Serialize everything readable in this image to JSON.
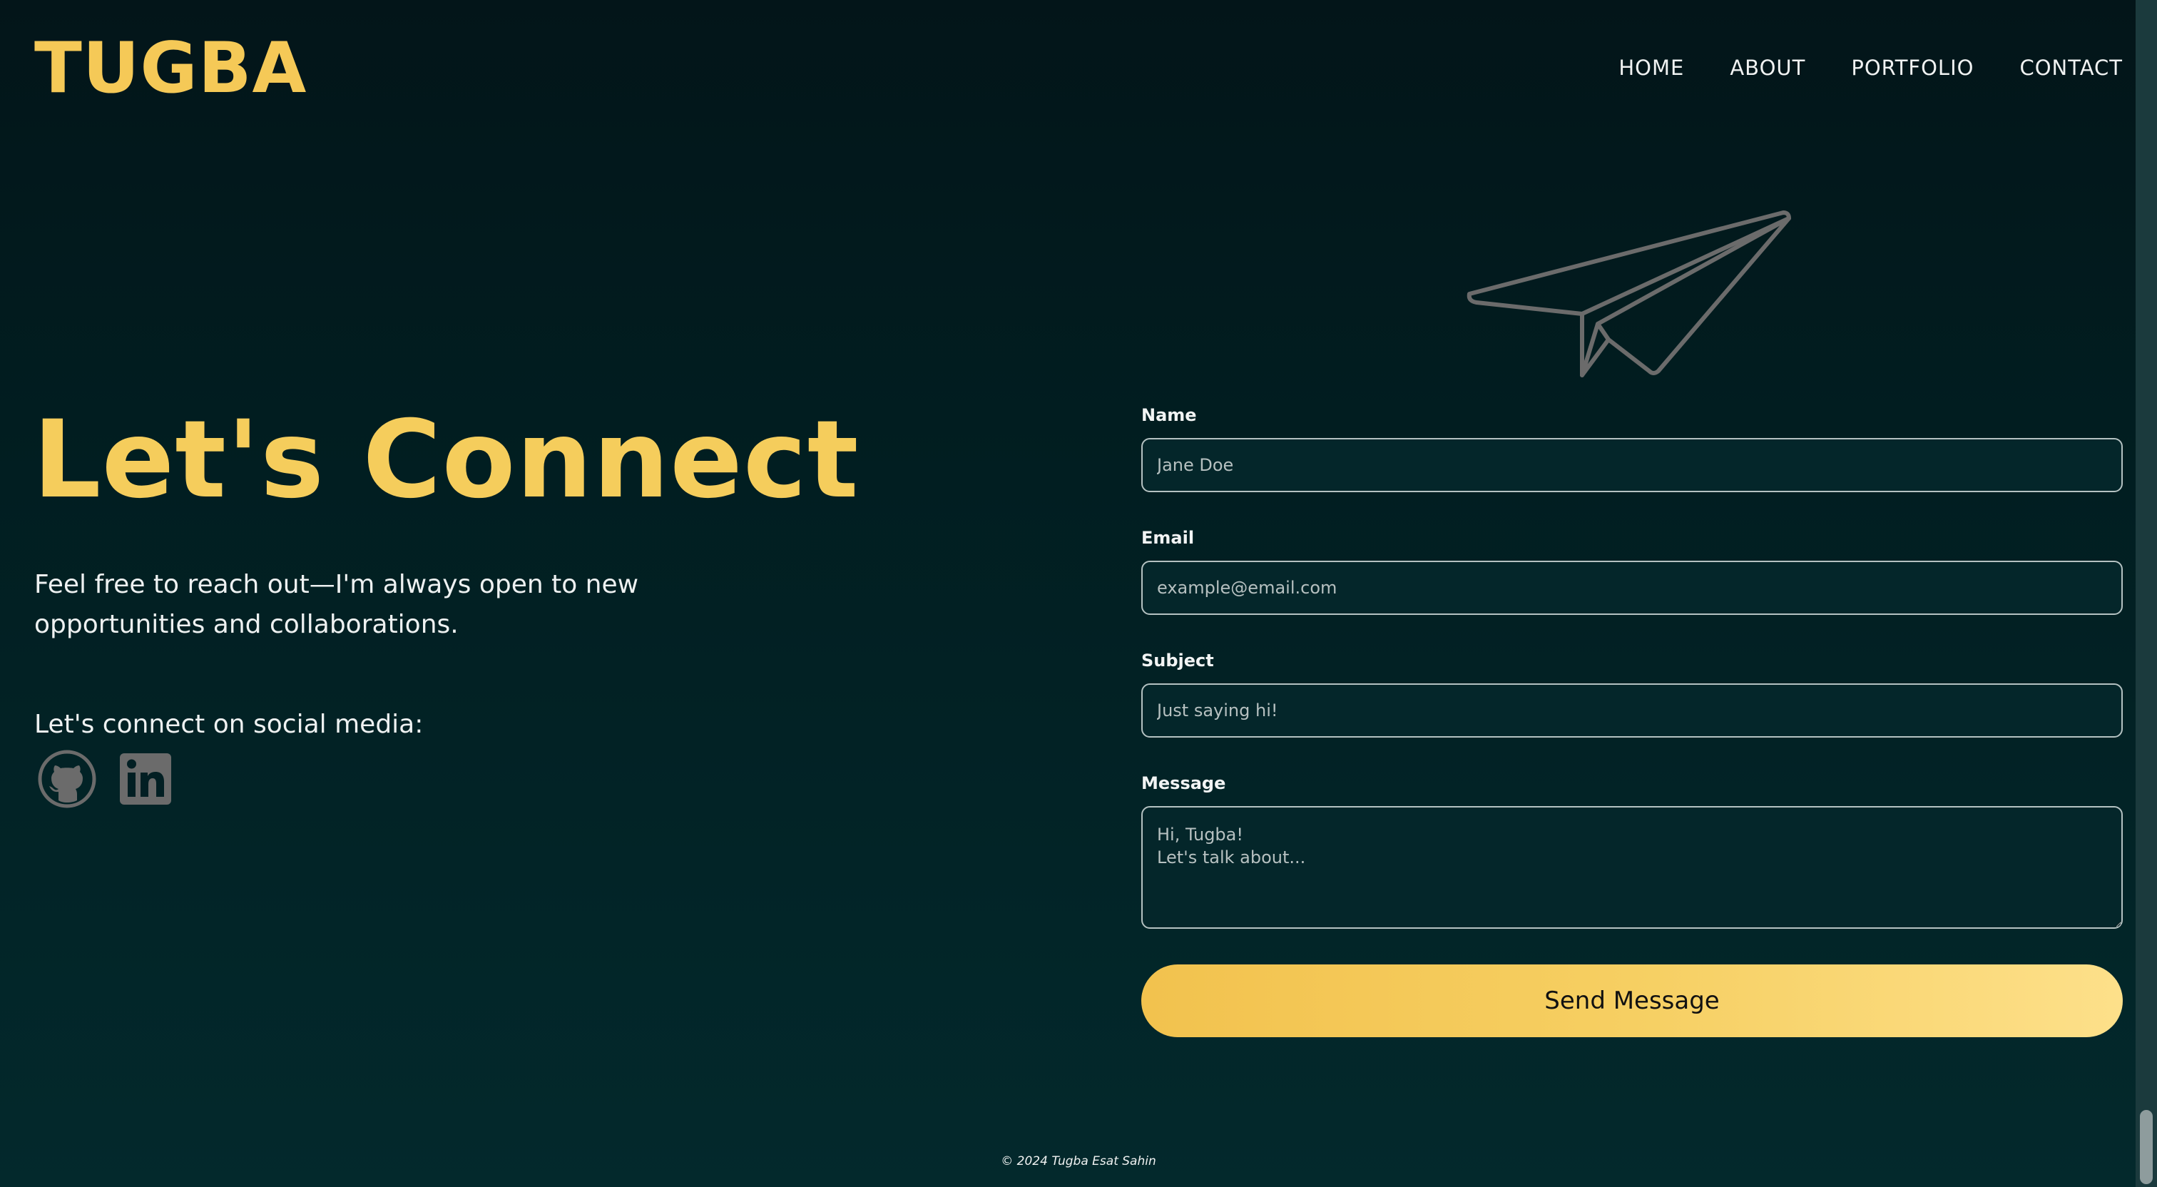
{
  "header": {
    "brand": "TUGBA",
    "nav": [
      "HOME",
      "ABOUT",
      "PORTFOLIO",
      "CONTACT"
    ]
  },
  "hero": {
    "title": "Let's Connect",
    "intro": "Feel free to reach out—I'm always open to new opportunities and collaborations.",
    "social_heading": "Let's connect on social media:",
    "social_icons": [
      "github-icon",
      "linkedin-icon"
    ]
  },
  "form": {
    "name_label": "Name",
    "name_placeholder": "Jane Doe",
    "email_label": "Email",
    "email_placeholder": "example@email.com",
    "subject_label": "Subject",
    "subject_placeholder": "Just saying hi!",
    "message_label": "Message",
    "message_placeholder": "Hi, Tugba!\nLet's talk about...",
    "submit_label": "Send Message"
  },
  "footer": {
    "copyright": "© 2024 Tugba Esat Sahin"
  },
  "colors": {
    "accent": "#f5c957",
    "background_top": "#031519",
    "background_bottom": "#03292c",
    "icon_gray": "#6b6b6b"
  }
}
